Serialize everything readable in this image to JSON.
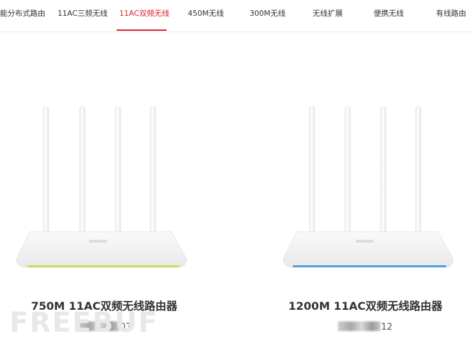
{
  "nav": {
    "items": [
      {
        "label": "能分布式路由"
      },
      {
        "label": "11AC三频无线"
      },
      {
        "label": "11AC双频无线"
      },
      {
        "label": "450M无线"
      },
      {
        "label": "300M无线"
      },
      {
        "label": "无线扩展"
      },
      {
        "label": "便携无线"
      },
      {
        "label": "有线路由"
      }
    ],
    "active_index": 2,
    "active_color": "#d9232d"
  },
  "products": [
    {
      "title": "750M 11AC双频无线路由器",
      "model_suffix": "07",
      "led_color": "#c8e05a"
    },
    {
      "title": "1200M 11AC双频无线路由器",
      "model_suffix": "12",
      "led_color": "#4a9fe0"
    }
  ],
  "watermark": "FREEBUF"
}
